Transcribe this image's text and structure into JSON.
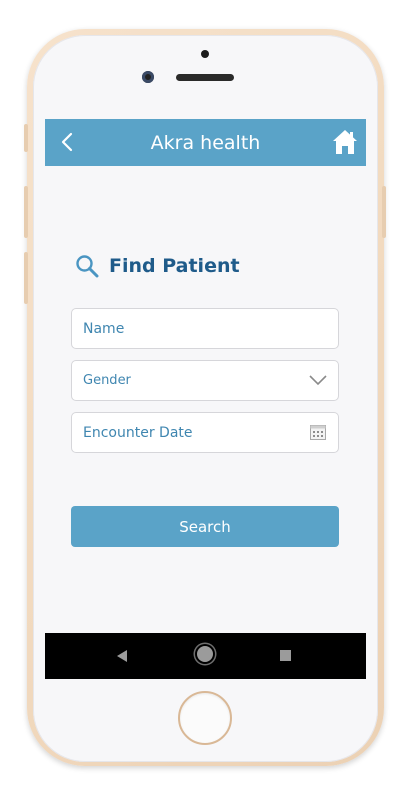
{
  "app_bar": {
    "title": "Akra health",
    "back_icon": "chevron-left-icon",
    "home_icon": "home-icon",
    "color": "#5aa3c8"
  },
  "find_patient": {
    "icon": "search-icon",
    "title": "Find Patient"
  },
  "form": {
    "name_placeholder": "Name",
    "gender_label": "Gender",
    "encounter_date_placeholder": "Encounter Date"
  },
  "search_button": {
    "label": "Search",
    "color": "#5aa3c8"
  },
  "system_nav": {
    "back_icon": "triangle-back-icon",
    "home_icon": "circle-home-icon",
    "recent_icon": "square-recent-icon"
  }
}
